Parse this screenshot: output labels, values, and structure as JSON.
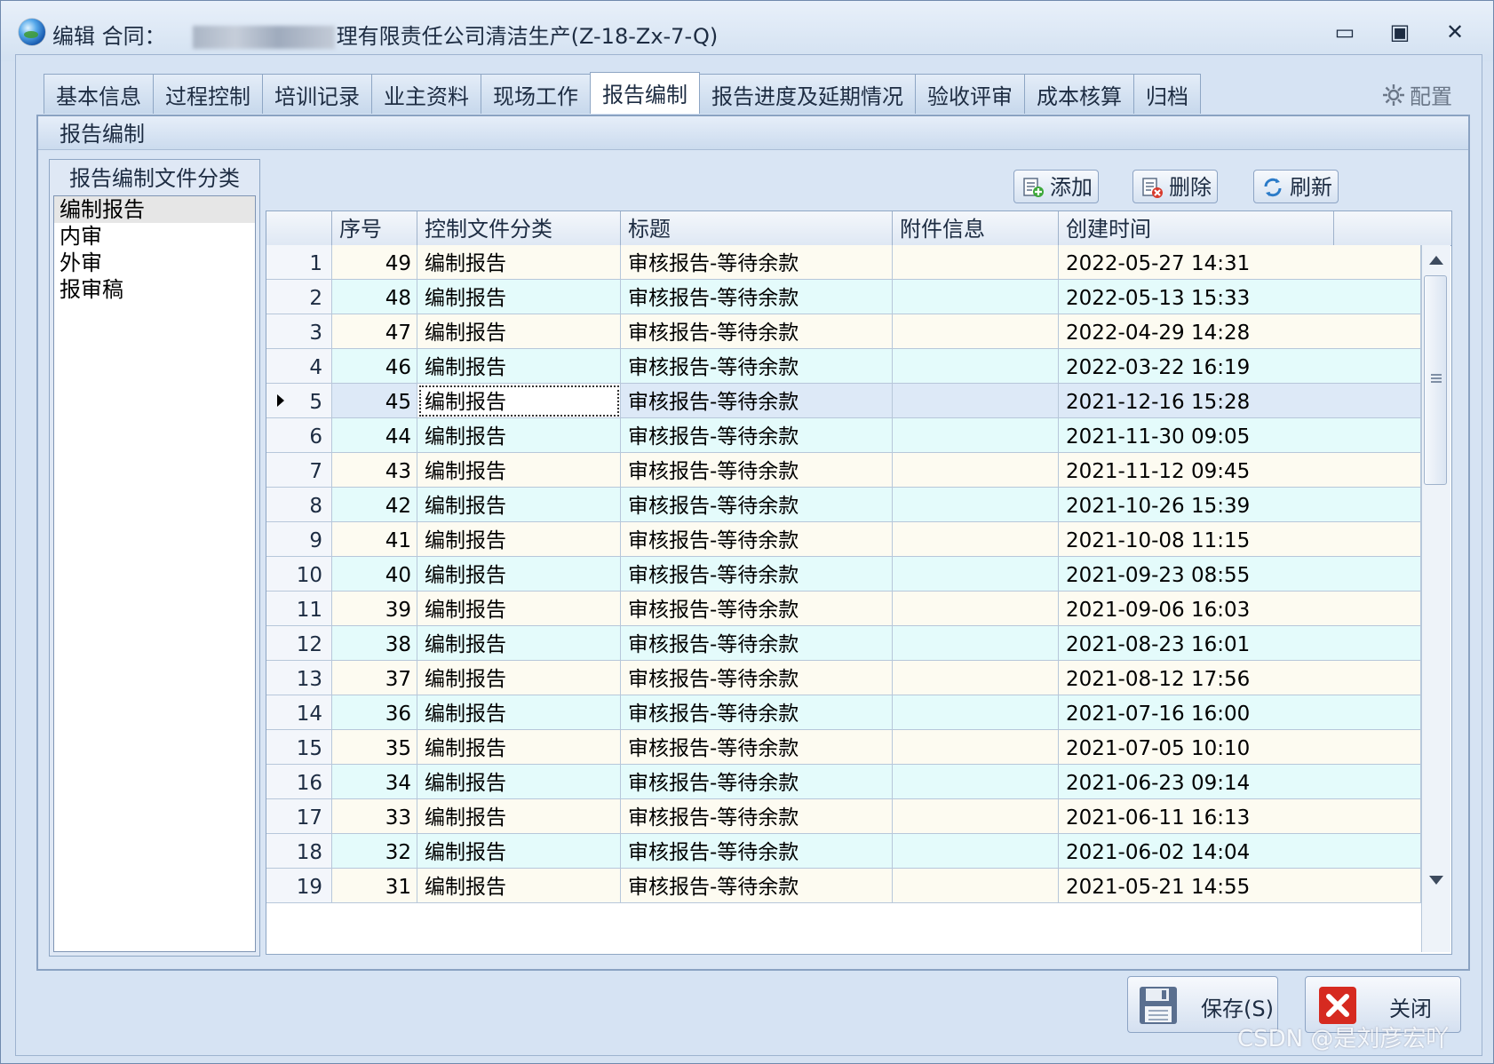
{
  "window": {
    "title_prefix": "编辑 合同：",
    "title_suffix": "理有限责任公司清洁生产(Z-18-Zx-7-Q)",
    "controls": {
      "minimize": "▭",
      "maximize": "▣",
      "close": "✕"
    }
  },
  "tabs": [
    {
      "label": "基本信息"
    },
    {
      "label": "过程控制"
    },
    {
      "label": "培训记录"
    },
    {
      "label": "业主资料"
    },
    {
      "label": "现场工作"
    },
    {
      "label": "报告编制",
      "active": true
    },
    {
      "label": "报告进度及延期情况"
    },
    {
      "label": "验收评审"
    },
    {
      "label": "成本核算"
    },
    {
      "label": "归档"
    }
  ],
  "config_label": "配置",
  "section_title": "报告编制",
  "category_panel": {
    "title": "报告编制文件分类",
    "items": [
      "编制报告",
      "内审",
      "外审",
      "报审稿"
    ],
    "selected_index": 0
  },
  "toolbar": {
    "add": "添加",
    "delete": "删除",
    "refresh": "刷新"
  },
  "grid": {
    "columns": [
      "",
      "序号",
      "控制文件分类",
      "标题",
      "附件信息",
      "创建时间"
    ],
    "current_row_index": 4,
    "rows": [
      {
        "n": "1",
        "seq": "49",
        "category": "编制报告",
        "title": "审核报告-等待余款",
        "attachment": "",
        "created": "2022-05-27 14:31"
      },
      {
        "n": "2",
        "seq": "48",
        "category": "编制报告",
        "title": "审核报告-等待余款",
        "attachment": "",
        "created": "2022-05-13 15:33"
      },
      {
        "n": "3",
        "seq": "47",
        "category": "编制报告",
        "title": "审核报告-等待余款",
        "attachment": "",
        "created": "2022-04-29 14:28"
      },
      {
        "n": "4",
        "seq": "46",
        "category": "编制报告",
        "title": "审核报告-等待余款",
        "attachment": "",
        "created": "2022-03-22 16:19"
      },
      {
        "n": "5",
        "seq": "45",
        "category": "编制报告",
        "title": "审核报告-等待余款",
        "attachment": "",
        "created": "2021-12-16 15:28"
      },
      {
        "n": "6",
        "seq": "44",
        "category": "编制报告",
        "title": "审核报告-等待余款",
        "attachment": "",
        "created": "2021-11-30 09:05"
      },
      {
        "n": "7",
        "seq": "43",
        "category": "编制报告",
        "title": "审核报告-等待余款",
        "attachment": "",
        "created": "2021-11-12 09:45"
      },
      {
        "n": "8",
        "seq": "42",
        "category": "编制报告",
        "title": "审核报告-等待余款",
        "attachment": "",
        "created": "2021-10-26 15:39"
      },
      {
        "n": "9",
        "seq": "41",
        "category": "编制报告",
        "title": "审核报告-等待余款",
        "attachment": "",
        "created": "2021-10-08 11:15"
      },
      {
        "n": "10",
        "seq": "40",
        "category": "编制报告",
        "title": "审核报告-等待余款",
        "attachment": "",
        "created": "2021-09-23 08:55"
      },
      {
        "n": "11",
        "seq": "39",
        "category": "编制报告",
        "title": "审核报告-等待余款",
        "attachment": "",
        "created": "2021-09-06 16:03"
      },
      {
        "n": "12",
        "seq": "38",
        "category": "编制报告",
        "title": "审核报告-等待余款",
        "attachment": "",
        "created": "2021-08-23 16:01"
      },
      {
        "n": "13",
        "seq": "37",
        "category": "编制报告",
        "title": "审核报告-等待余款",
        "attachment": "",
        "created": "2021-08-12 17:56"
      },
      {
        "n": "14",
        "seq": "36",
        "category": "编制报告",
        "title": "审核报告-等待余款",
        "attachment": "",
        "created": "2021-07-16 16:00"
      },
      {
        "n": "15",
        "seq": "35",
        "category": "编制报告",
        "title": "审核报告-等待余款",
        "attachment": "",
        "created": "2021-07-05 10:10"
      },
      {
        "n": "16",
        "seq": "34",
        "category": "编制报告",
        "title": "审核报告-等待余款",
        "attachment": "",
        "created": "2021-06-23 09:14"
      },
      {
        "n": "17",
        "seq": "33",
        "category": "编制报告",
        "title": "审核报告-等待余款",
        "attachment": "",
        "created": "2021-06-11 16:13"
      },
      {
        "n": "18",
        "seq": "32",
        "category": "编制报告",
        "title": "审核报告-等待余款",
        "attachment": "",
        "created": "2021-06-02 14:04"
      },
      {
        "n": "19",
        "seq": "31",
        "category": "编制报告",
        "title": "审核报告-等待余款",
        "attachment": "",
        "created": "2021-05-21 14:55"
      }
    ]
  },
  "footer": {
    "save": "保存(S)",
    "close": "关闭"
  },
  "watermark": "CSDN @是刘彦宏吖",
  "colors": {
    "row_odd": "#fdfbf1",
    "row_even": "#e4fbfb",
    "row_current": "#dde9f7",
    "close_icon": "#d62a20",
    "frame": "#d5e2f2"
  }
}
